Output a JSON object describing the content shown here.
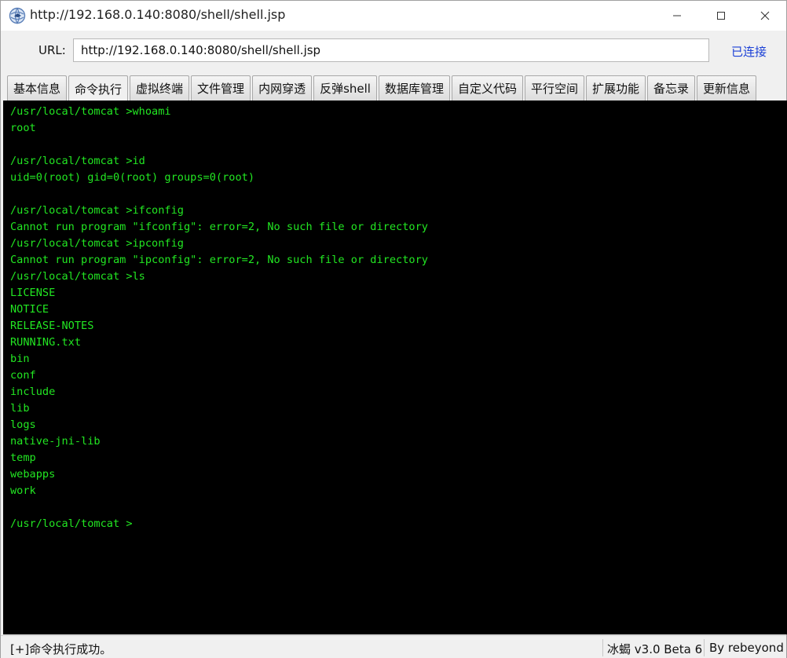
{
  "window": {
    "title": "http://192.168.0.140:8080/shell/shell.jsp",
    "icon": "globe-bird-icon"
  },
  "urlbar": {
    "label": "URL:",
    "value": "http://192.168.0.140:8080/shell/shell.jsp",
    "status": "已连接",
    "status_color": "#1a3fd6"
  },
  "tabs": [
    {
      "label": "基本信息",
      "active": false
    },
    {
      "label": "命令执行",
      "active": true
    },
    {
      "label": "虚拟终端",
      "active": false
    },
    {
      "label": "文件管理",
      "active": false
    },
    {
      "label": "内网穿透",
      "active": false
    },
    {
      "label": "反弹shell",
      "active": false
    },
    {
      "label": "数据库管理",
      "active": false
    },
    {
      "label": "自定义代码",
      "active": false
    },
    {
      "label": "平行空间",
      "active": false
    },
    {
      "label": "扩展功能",
      "active": false
    },
    {
      "label": "备忘录",
      "active": false
    },
    {
      "label": "更新信息",
      "active": false
    }
  ],
  "terminal": {
    "text_color": "#22e622",
    "background": "#000000",
    "lines": [
      "/usr/local/tomcat >whoami",
      "root",
      "",
      "/usr/local/tomcat >id",
      "uid=0(root) gid=0(root) groups=0(root)",
      "",
      "/usr/local/tomcat >ifconfig",
      "Cannot run program \"ifconfig\": error=2, No such file or directory",
      "/usr/local/tomcat >ipconfig",
      "Cannot run program \"ipconfig\": error=2, No such file or directory",
      "/usr/local/tomcat >ls",
      "LICENSE",
      "NOTICE",
      "RELEASE-NOTES",
      "RUNNING.txt",
      "bin",
      "conf",
      "include",
      "lib",
      "logs",
      "native-jni-lib",
      "temp",
      "webapps",
      "work",
      "",
      "/usr/local/tomcat > "
    ]
  },
  "statusbar": {
    "message": "[+]命令执行成功。",
    "version": "冰蝎 v3.0 Beta 6",
    "author": "By rebeyond"
  }
}
